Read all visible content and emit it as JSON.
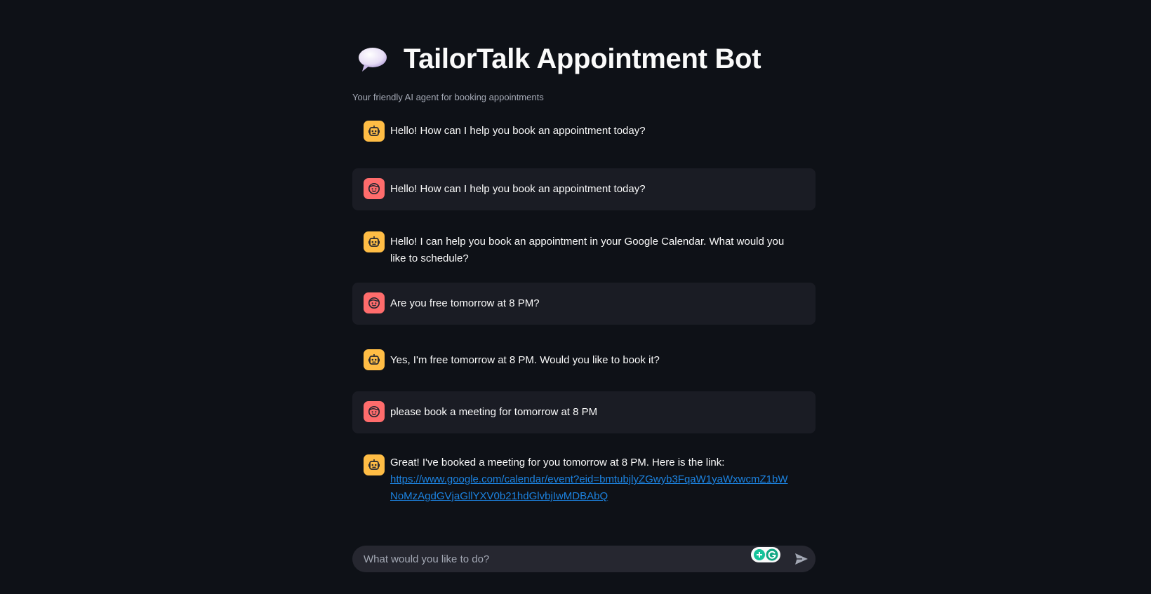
{
  "header": {
    "title": "TailorTalk Appointment Bot",
    "subtitle": "Your friendly AI agent for booking appointments",
    "icon": "speech-bubble-icon"
  },
  "messages": [
    {
      "role": "assistant",
      "text": "Hello! How can I help you book an appointment today?"
    },
    {
      "role": "user",
      "text": "Hello! How can I help you book an appointment today?"
    },
    {
      "role": "assistant",
      "text": "Hello! I can help you book an appointment in your Google Calendar. What would you like to schedule?"
    },
    {
      "role": "user",
      "text": "Are you free tomorrow at 8 PM?"
    },
    {
      "role": "assistant",
      "text": "Yes, I'm free tomorrow at 8 PM. Would you like to book it?"
    },
    {
      "role": "user",
      "text": "please book a meeting for tomorrow at 8 PM"
    },
    {
      "role": "assistant",
      "text": "Great! I've booked a meeting for you tomorrow at 8 PM. Here is the link:",
      "link": "https://www.google.com/calendar/event?eid=bmtubjlyZGwyb3FqaW1yaWxwcmZ1bWNoMzAgdGVjaGllYXV0b21hdGlvbjIwMDBAbQ"
    }
  ],
  "chat_input": {
    "placeholder": "What would you like to do?",
    "value": ""
  },
  "colors": {
    "background": "#0e1117",
    "user_message_bg": "#1a1c24",
    "bot_avatar": "#ffbd45",
    "user_avatar": "#ff6c6c",
    "link": "#1c83e1"
  }
}
